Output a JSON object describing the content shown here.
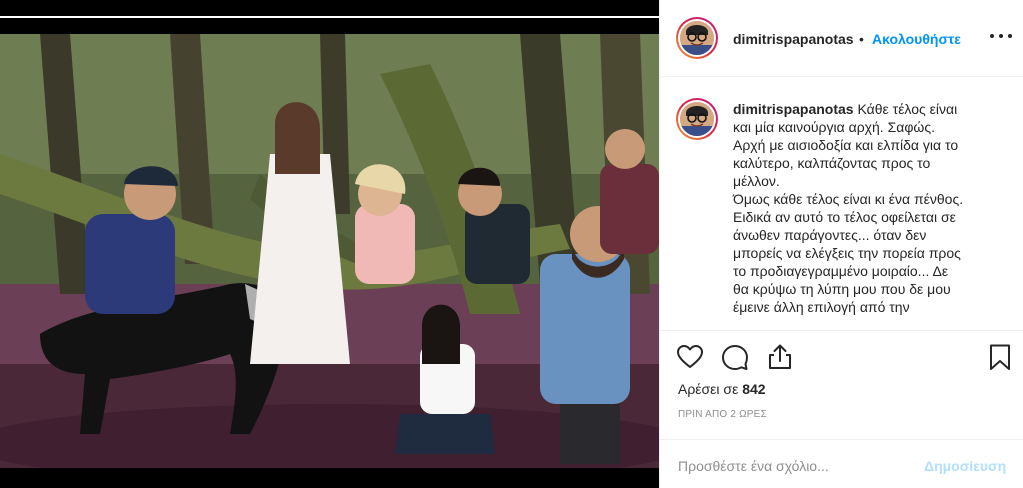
{
  "post": {
    "username": "dimitrispapanotas",
    "separator": "•",
    "follow_label": "Ακολουθήστε",
    "more_icon": "more-horizontal-icon",
    "caption_lines": [
      "Κάθε τέλος είναι",
      "και μία καινούργια αρχή. Σαφώς.",
      "Αρχή με αισιοδοξία και ελπίδα για το",
      "καλύτερο, καλπάζοντας προς το",
      "μέλλον.",
      "Όμως κάθε τέλος είναι κι ένα πένθος.",
      "Ειδικά αν αυτό το τέλος οφείλεται σε",
      "άνωθεν παράγοντες... όταν δεν",
      "μπορείς να ελέγξεις την πορεία προς",
      "το προδιαγεγραμμένο μοιραίο... Δε",
      "θα κρύψω τη λύπη μου που δε μου",
      "έμεινε άλλη επιλογή από την"
    ],
    "likes_prefix": "Αρέσει σε",
    "likes_count": "842",
    "time_label": "ΠΡΙΝ ΑΠΟ 2 ΩΡΕΣ",
    "comment_placeholder": "Προσθέστε ένα σχόλιο...",
    "post_button": "Δημοσίευση",
    "icons": {
      "like": "heart-icon",
      "comment": "comment-bubble-icon",
      "share": "share-icon",
      "save": "bookmark-icon"
    },
    "colors": {
      "accent": "#0095f6",
      "post_disabled": "#b2dffc",
      "muted": "#8e8e8e"
    }
  }
}
